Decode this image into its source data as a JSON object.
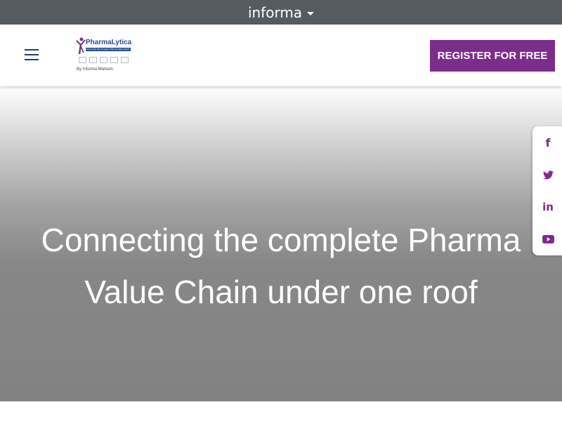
{
  "topbar": {
    "brand": "informa"
  },
  "header": {
    "logo": {
      "name": "PharmaLytica",
      "tagline": "Connecting the Complete Pharma Value Chain",
      "by": "By Informa Markets"
    },
    "register_label": "REGISTER FOR FREE"
  },
  "hero": {
    "title_line1": "Connecting the complete Pharma",
    "title_line2": "Value Chain under one roof"
  },
  "social": {
    "facebook": "f",
    "linkedin": "in"
  },
  "colors": {
    "accent": "#7b2d8b",
    "topbar": "#555b5e",
    "nav_icon": "#1c3f73"
  }
}
